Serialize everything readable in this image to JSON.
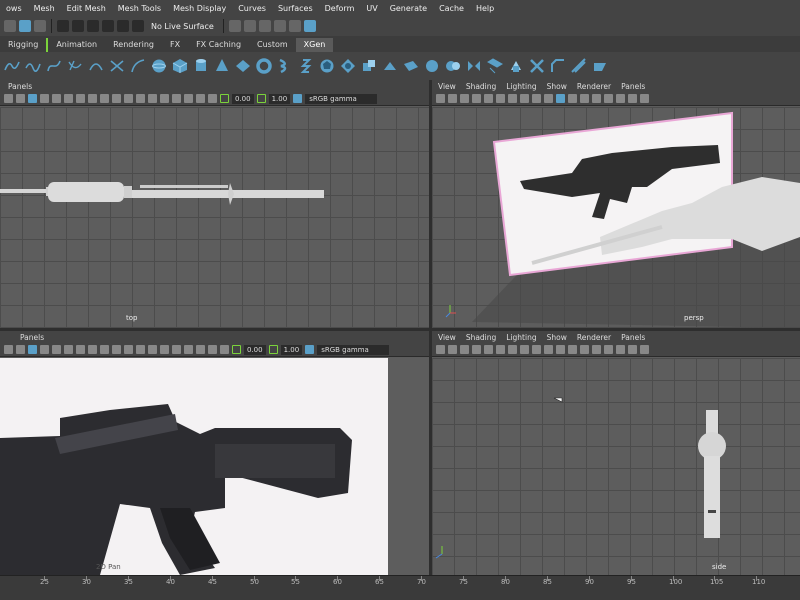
{
  "menubar": [
    "ows",
    "Mesh",
    "Edit Mesh",
    "Mesh Tools",
    "Mesh Display",
    "Curves",
    "Surfaces",
    "Deform",
    "UV",
    "Generate",
    "Cache",
    "Help"
  ],
  "statusbar": {
    "live_surface": "No Live Surface"
  },
  "shelf_tabs": [
    {
      "label": "Rigging",
      "active": false
    },
    {
      "label": "Animation",
      "active": false
    },
    {
      "label": "Rendering",
      "active": false
    },
    {
      "label": "FX",
      "active": false
    },
    {
      "label": "FX Caching",
      "active": false
    },
    {
      "label": "Custom",
      "active": false
    },
    {
      "label": "XGen",
      "active": true
    }
  ],
  "pane_menu_full": [
    "View",
    "Shading",
    "Lighting",
    "Show",
    "Renderer",
    "Panels"
  ],
  "pane_menu_short": [
    "Panels"
  ],
  "pane_tools": {
    "exposure": "0.00",
    "gamma": "1.00",
    "colorspace": "sRGB gamma"
  },
  "panes": {
    "top": {
      "camera": "top"
    },
    "persp": {
      "camera": "persp"
    },
    "panel2d": {
      "camera": "2D Pan"
    },
    "side": {
      "camera": "side"
    }
  },
  "ruler": {
    "ticks": [
      "25",
      "30",
      "35",
      "40",
      "45",
      "50",
      "55",
      "60",
      "65",
      "70",
      "75",
      "80",
      "85",
      "90",
      "95",
      "100",
      "105",
      "110"
    ]
  },
  "colors": {
    "accent_green": "#7bd33b",
    "accent_blue": "#5aa0c8",
    "viewport_bg": "#5d5d5d",
    "plane_pink": "#e9c6e3"
  }
}
